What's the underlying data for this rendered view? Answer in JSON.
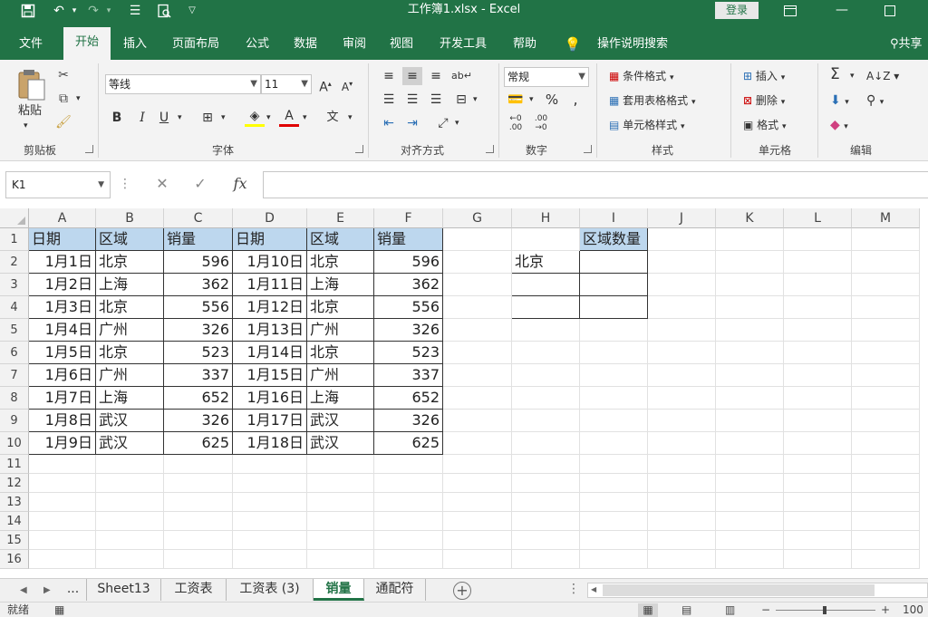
{
  "titlebar": {
    "title": "工作簿1.xlsx - Excel",
    "login": "登录",
    "icons": [
      "save-icon",
      "undo-icon",
      "redo-icon",
      "touch-mode-icon",
      "print-preview-icon",
      "customize-icon",
      "ribbon-display-icon",
      "minimize-icon",
      "maximize-icon"
    ]
  },
  "tabs": [
    "文件",
    "开始",
    "插入",
    "页面布局",
    "公式",
    "数据",
    "审阅",
    "视图",
    "开发工具",
    "帮助",
    "操作说明搜索",
    "共享"
  ],
  "ribbon": {
    "clipboard": {
      "paste": "粘贴",
      "label": "剪贴板"
    },
    "font": {
      "name": "等线",
      "size": "11",
      "bold": "B",
      "italic": "I",
      "underline": "U",
      "grow": "A",
      "shrink": "A",
      "color_letter": "A",
      "phonetic": "文",
      "label": "字体"
    },
    "align": {
      "label": "对齐方式"
    },
    "number": {
      "format": "常规",
      "percent": "%",
      "label": "数字"
    },
    "styles": {
      "cond": "条件格式",
      "table": "套用表格格式",
      "cell": "单元格样式",
      "label": "样式"
    },
    "cells": {
      "insert": "插入",
      "delete": "删除",
      "format": "格式",
      "label": "单元格"
    },
    "edit": {
      "sum": "Σ",
      "label": "编辑"
    }
  },
  "formulabar": {
    "namebox": "K1",
    "fx": "fx",
    "cancel": "✕",
    "enter": "✓",
    "value": ""
  },
  "columns": [
    "A",
    "B",
    "C",
    "D",
    "E",
    "F",
    "G",
    "H",
    "I",
    "J",
    "K",
    "L",
    "M"
  ],
  "rows": [
    "1",
    "2",
    "3",
    "4",
    "5",
    "6",
    "7",
    "8",
    "9",
    "10",
    "11",
    "12",
    "13",
    "14",
    "15",
    "16"
  ],
  "table": {
    "headers": [
      "日期",
      "区域",
      "销量",
      "日期",
      "区域",
      "销量"
    ],
    "rows": [
      [
        "1月1日",
        "北京",
        "596",
        "1月10日",
        "北京",
        "596"
      ],
      [
        "1月2日",
        "上海",
        "362",
        "1月11日",
        "上海",
        "362"
      ],
      [
        "1月3日",
        "北京",
        "556",
        "1月12日",
        "北京",
        "556"
      ],
      [
        "1月4日",
        "广州",
        "326",
        "1月13日",
        "广州",
        "326"
      ],
      [
        "1月5日",
        "北京",
        "523",
        "1月14日",
        "北京",
        "523"
      ],
      [
        "1月6日",
        "广州",
        "337",
        "1月15日",
        "广州",
        "337"
      ],
      [
        "1月7日",
        "上海",
        "652",
        "1月16日",
        "上海",
        "652"
      ],
      [
        "1月8日",
        "武汉",
        "326",
        "1月17日",
        "武汉",
        "326"
      ],
      [
        "1月9日",
        "武汉",
        "625",
        "1月18日",
        "武汉",
        "625"
      ]
    ]
  },
  "side_table": {
    "header": "区域数量",
    "rows": [
      "北京",
      "",
      ""
    ],
    "counts": [
      "",
      "",
      ""
    ]
  },
  "sheets": {
    "ellipsis": "...",
    "tabs": [
      "Sheet13",
      "工资表",
      "工资表 (3)",
      "销量",
      "通配符"
    ],
    "active": "销量"
  },
  "status": {
    "ready": "就绪",
    "zoom": "100"
  }
}
